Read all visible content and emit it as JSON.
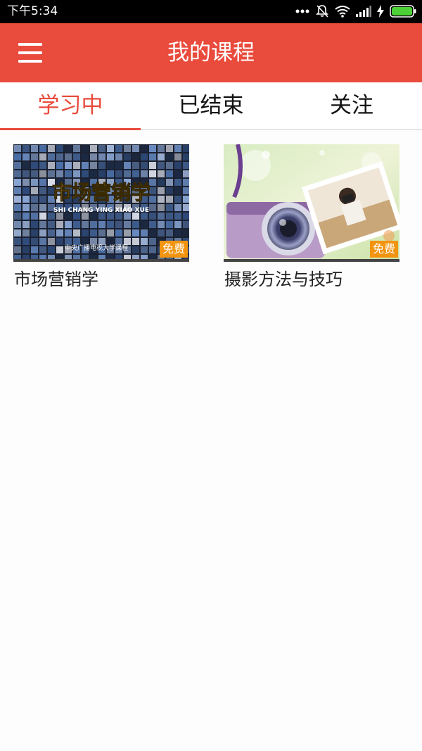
{
  "status_bar": {
    "time": "下午5:34",
    "icons": [
      "more-dots-icon",
      "bell-muted-icon",
      "wifi-icon",
      "signal-icon",
      "charging-icon",
      "battery-icon"
    ]
  },
  "header": {
    "title": "我的课程",
    "menu_icon": "hamburger-menu-icon",
    "background": "#e94b3c"
  },
  "tabs": [
    {
      "label": "学习中",
      "active": true
    },
    {
      "label": "已结束",
      "active": false
    },
    {
      "label": "关注",
      "active": false
    }
  ],
  "courses": [
    {
      "title": "市场营销学",
      "badge": "免费",
      "thumbnail": {
        "headline": "市场营销学",
        "pinyin": "SHI CHANG YING XIAO XUE",
        "caption": "中央广播电视大学课程"
      }
    },
    {
      "title": "摄影方法与技巧",
      "badge": "免费"
    }
  ],
  "colors": {
    "accent": "#e94b3c",
    "badge": "#f2940f"
  }
}
